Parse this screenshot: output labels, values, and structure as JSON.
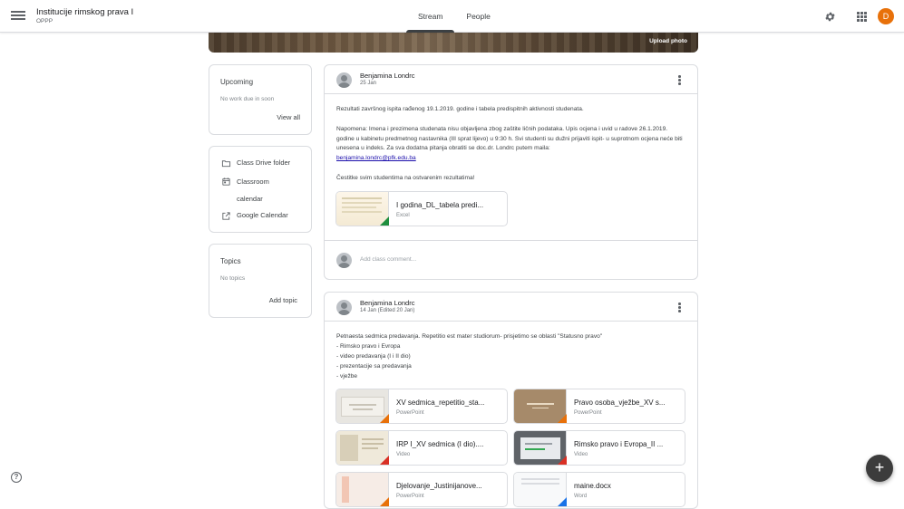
{
  "header": {
    "class_name": "Institucije rimskog prava I",
    "section": "OPPP",
    "tabs": [
      "Stream",
      "People"
    ],
    "active_tab": "Stream",
    "avatar_letter": "D",
    "avatar_color": "#e8710a"
  },
  "banner": {
    "upload_label": "Upload photo"
  },
  "upcoming": {
    "title": "Upcoming",
    "empty": "No work due in soon",
    "view_all": "View all"
  },
  "links": {
    "drive": "Class Drive folder",
    "calendar_line1": "Classroom",
    "calendar_line2": "calendar",
    "google_calendar": "Google Calendar"
  },
  "topics": {
    "title": "Topics",
    "empty": "No topics",
    "add": "Add topic"
  },
  "posts": [
    {
      "author": "Benjamina Londrc",
      "date": "25 Jan",
      "text": [
        "Rezultati završnog ispita rađenog 19.1.2019. godine i tabela predispitnih aktivnosti studenata.",
        "Napomena: Imena i prezimena studenata nisu objavljena zbog zaštite ličnih podataka. Upis ocjena i uvid u radove 26.1.2019. godine u kabinetu predmetnog nastavnika (III sprat lijevo) u 9:30 h. Svi studenti su dužni prijaviti ispit- u suprotnom ocjena neće biti unesena u indeks. Za sva dodatna pitanja obratiti se doc.dr. Londrc putem maila:",
        "benjamina.londrc@pfk.edu.ba",
        "Čestitke svim studentima na ostvarenim rezultatima!"
      ],
      "attachments": [
        {
          "name": "I godina_DL_tabela predi...",
          "type": "Excel"
        }
      ],
      "comment_placeholder": "Add class comment..."
    },
    {
      "author": "Benjamina Londrc",
      "date": "14 Jan (Edited 20 Jan)",
      "text": [
        "Petnaesta sedmica predavanja. Repetitio est mater studiorum- prisjetimo se oblasti \"Statusno pravo\"",
        "- Rimsko pravo i Evropa",
        "- video predavanja (I i II dio)",
        "- prezentacije sa predavanja",
        "- vježbe"
      ],
      "attachments": [
        {
          "name": "XV sedmica_repetitio_sta...",
          "type": "PowerPoint"
        },
        {
          "name": "Pravo osoba_vježbe_XV s...",
          "type": "PowerPoint"
        },
        {
          "name": "IRP I_XV sedmica (I dio)....",
          "type": "Video"
        },
        {
          "name": "Rimsko pravo i Evropa_II ...",
          "type": "Video"
        },
        {
          "name": "Djelovanje_Justinijanove...",
          "type": "PowerPoint"
        },
        {
          "name": "maine.docx",
          "type": "Word"
        }
      ]
    }
  ],
  "help_glyph": "?",
  "fab_glyph": "+"
}
